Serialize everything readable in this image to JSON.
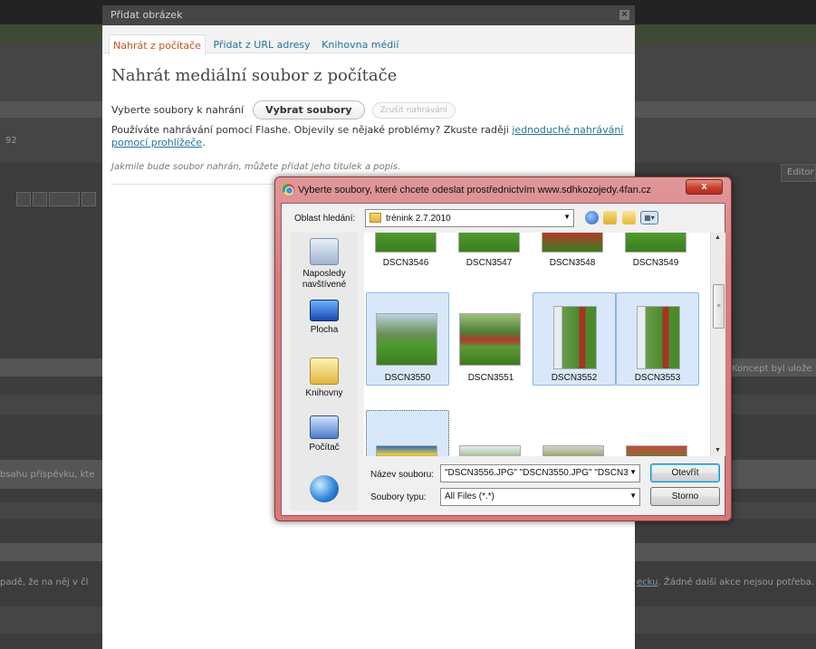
{
  "background": {
    "number_fragment": "92",
    "editor_tab": "Editor",
    "draft_status": "Koncept byl ulože",
    "content_text": "bsahu příspěvku, kte",
    "bottom_text_left": "padě, že na něj v čl",
    "bottom_link": "ecku",
    "bottom_text_right": ". Žádné další akce nejsou potřeba."
  },
  "modal": {
    "title": "Přidat obrázek",
    "close": "×",
    "tabs": [
      {
        "label": "Nahrát z počítače",
        "active": true
      },
      {
        "label": "Přidat z URL adresy",
        "active": false
      },
      {
        "label": "Knihovna médií",
        "active": false
      }
    ],
    "heading": "Nahrát mediální soubor z počítače",
    "select_label": "Vyberte soubory k nahrání",
    "select_button": "Vybrat soubory",
    "cancel_upload_button": "Zrušit nahrávání",
    "flash_text": "Používáte nahrávání pomocí Flashe. Objevily se nějaké problémy? Zkuste raději ",
    "flash_link": "jednoduché nahrávání pomocí prohlížeče",
    "flash_end": ".",
    "hint": "Jakmile bude soubor nahrán, můžete přidat jeho titulek a popis."
  },
  "dialog": {
    "title": "Vyberte soubory, které chcete odeslat prostřednictvím www.sdhkozojedy.4fan.cz",
    "close": "x",
    "look_in_label": "Oblast hledání:",
    "look_in_value": "trénink 2.7.2010",
    "places": [
      {
        "label": "Naposledy navštívené",
        "icon": "recent-places-icon"
      },
      {
        "label": "Plocha",
        "icon": "desktop-icon"
      },
      {
        "label": "Knihovny",
        "icon": "libraries-icon"
      },
      {
        "label": "Počítač",
        "icon": "computer-icon"
      },
      {
        "label": "",
        "icon": "network-icon"
      }
    ],
    "row1_names": [
      "DSCN3546",
      "DSCN3547",
      "DSCN3548",
      "DSCN3549"
    ],
    "row2": [
      {
        "name": "DSCN3550",
        "selected": true
      },
      {
        "name": "DSCN3551",
        "selected": false
      },
      {
        "name": "DSCN3552",
        "selected": true
      },
      {
        "name": "DSCN3553",
        "selected": true
      }
    ],
    "file_name_label": "Název souboru:",
    "file_name_value": "\"DSCN3556.JPG\" \"DSCN3550.JPG\" \"DSCN3",
    "file_type_label": "Soubory typu:",
    "file_type_value": "All Files (*.*)",
    "open_button": "Otevřít",
    "cancel_button": "Storno"
  }
}
